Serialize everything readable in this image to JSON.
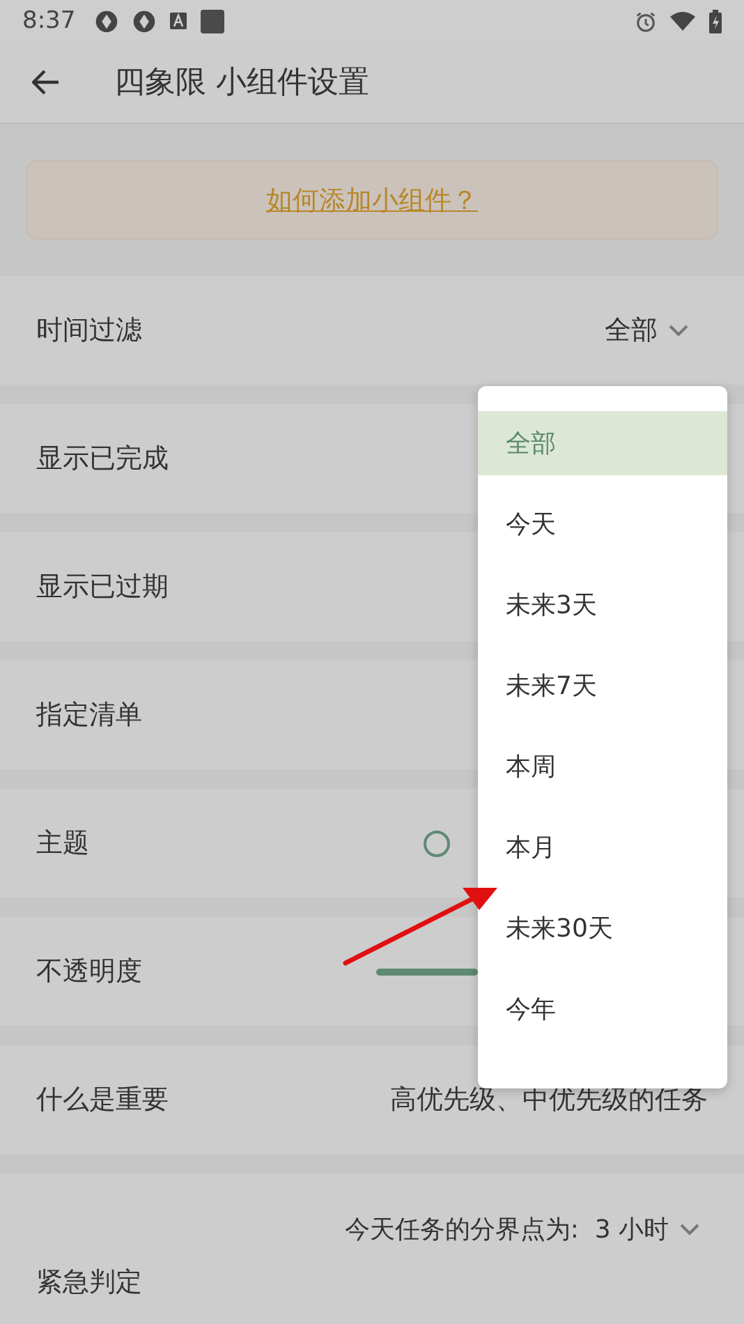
{
  "status_bar": {
    "time": "8:37"
  },
  "app_bar": {
    "title": "四象限 小组件设置"
  },
  "help_link": "如何添加小组件？",
  "settings": [
    {
      "kind": "dropdown",
      "label": "时间过滤",
      "value": "全部"
    },
    {
      "kind": "plain",
      "label": "显示已完成"
    },
    {
      "kind": "plain",
      "label": "显示已过期"
    },
    {
      "kind": "plain",
      "label": "指定清单"
    },
    {
      "kind": "radio",
      "label": "主题",
      "selected": false
    },
    {
      "kind": "slider",
      "label": "不透明度"
    },
    {
      "kind": "value",
      "label": "什么是重要",
      "value": "高优先级、中优先级的任务"
    },
    {
      "kind": "tall_dropdown",
      "label": "紧急判定",
      "value": "今天任务的分界点为:  3 小时"
    }
  ],
  "menu": [
    {
      "label": "全部",
      "selected": true
    },
    {
      "label": "今天",
      "selected": false
    },
    {
      "label": "未来3天",
      "selected": false
    },
    {
      "label": "未来7天",
      "selected": false
    },
    {
      "label": "本周",
      "selected": false
    },
    {
      "label": "本月",
      "selected": false
    },
    {
      "label": "未来30天",
      "selected": false
    },
    {
      "label": "今年",
      "selected": false
    }
  ]
}
